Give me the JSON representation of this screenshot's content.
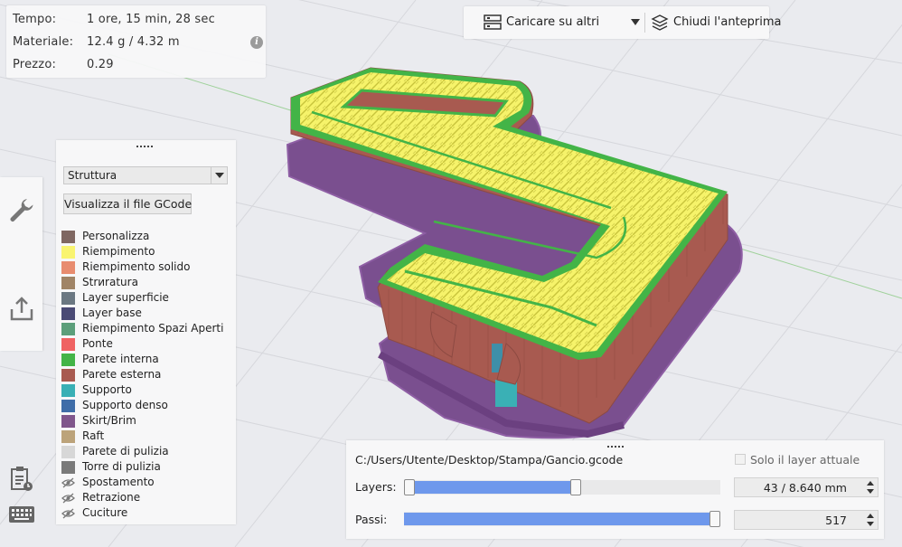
{
  "stats": {
    "time_label": "Tempo:",
    "time_value": "1 ore, 15 min, 28 sec",
    "material_label": "Materiale:",
    "material_value": "12.4 g / 4.32 m",
    "price_label": "Prezzo:",
    "price_value": "0.29",
    "info_icon": "info-icon"
  },
  "toolbar": {
    "upload_label": "Caricare su altri",
    "upload_icon": "server-upload-icon",
    "close_preview_label": "Chiudi l'anteprima",
    "close_preview_icon": "layers-icon"
  },
  "sidebar": {
    "items": [
      {
        "icon": "wrench-icon"
      },
      {
        "icon": "export-icon"
      }
    ],
    "bottom_icons": [
      "gcode-icon",
      "keyboard-icon"
    ]
  },
  "legend": {
    "view_mode": "Struttura",
    "gcode_button": "Visualizza il file GCode",
    "items": [
      {
        "label": "Personalizza",
        "color": "#7f6762",
        "visible": true
      },
      {
        "label": "Riempimento",
        "color": "#f9f470",
        "visible": true
      },
      {
        "label": "Riempimento solido",
        "color": "#e88c6f",
        "visible": true
      },
      {
        "label": "Strиratura",
        "color": "#a08466",
        "visible": true
      },
      {
        "label": "Layer superficie",
        "color": "#6b7882",
        "visible": true
      },
      {
        "label": "Layer base",
        "color": "#4a4a75",
        "visible": true
      },
      {
        "label": "Riempimento Spazi Aperti",
        "color": "#5c9f7b",
        "visible": true
      },
      {
        "label": "Ponte",
        "color": "#ef6262",
        "visible": true
      },
      {
        "label": "Parete interna",
        "color": "#43b447",
        "visible": true
      },
      {
        "label": "Parete esterna",
        "color": "#a85a50",
        "visible": true
      },
      {
        "label": "Supporto",
        "color": "#3ab0b5",
        "visible": true
      },
      {
        "label": "Supporto denso",
        "color": "#3f6da8",
        "visible": true
      },
      {
        "label": "Skirt/Brim",
        "color": "#80568c",
        "visible": true
      },
      {
        "label": "Raft",
        "color": "#bca37a",
        "visible": true
      },
      {
        "label": "Parete di pulizia",
        "color": "#d7d7d7",
        "visible": true
      },
      {
        "label": "Torre di pulizia",
        "color": "#7a7a7a",
        "visible": true
      },
      {
        "label": "Spostamento",
        "color": "",
        "visible": false,
        "icon": "eye-hidden-icon"
      },
      {
        "label": "Retrazione",
        "color": "",
        "visible": false,
        "icon": "eye-hidden-icon"
      },
      {
        "label": "Cuciture",
        "color": "",
        "visible": false,
        "icon": "eye-hidden-icon"
      }
    ]
  },
  "layer_panel": {
    "file_path": "C:/Users/Utente/Desktop/Stampa/Gancio.gcode",
    "only_current_layer_label": "Solo il layer attuale",
    "only_current_layer_checked": false,
    "layers_label": "Layers:",
    "layers_value": "43 / 8.640 mm",
    "layers_range": [
      0.0,
      0.545
    ],
    "passes_label": "Passi:",
    "passes_value": "517",
    "passes_fraction": 1.0
  }
}
